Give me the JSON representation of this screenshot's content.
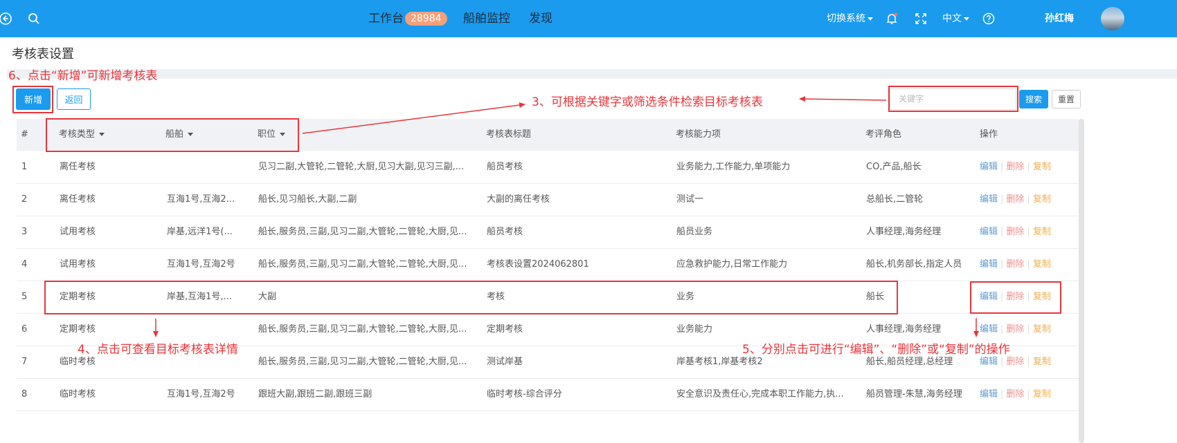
{
  "header": {
    "nav": [
      {
        "label": "工作台",
        "badge": "28984"
      },
      {
        "label": "船舶监控"
      },
      {
        "label": "发现"
      }
    ],
    "switch_system": "切换系统",
    "language": "中文",
    "user_name": "孙红梅"
  },
  "page": {
    "title": "考核表设置"
  },
  "toolbar": {
    "add_label": "新增",
    "back_label": "返回",
    "search_placeholder": "关键字",
    "search_label": "搜索",
    "reset_label": "重置"
  },
  "table": {
    "columns": [
      "#",
      "考核类型",
      "船舶",
      "职位",
      "考核表标题",
      "考核能力项",
      "考评角色",
      "操作"
    ],
    "actions": {
      "edit": "编辑",
      "delete": "删除",
      "copy": "复制"
    },
    "rows": [
      [
        "1",
        "离任考核",
        "",
        "见习二副,大管轮,二管轮,大厨,见习大副,见习三副,...",
        "船员考核",
        "业务能力,工作能力,单项能力",
        "CO,产品,船长"
      ],
      [
        "2",
        "离任考核",
        "互海1号,互海2...",
        "船长,见习船长,大副,二副",
        "大副的离任考核",
        "测试一",
        "总船长,二管轮"
      ],
      [
        "3",
        "试用考核",
        "岸基,远洋1号(...",
        "船长,服务员,三副,见习二副,大管轮,二管轮,大厨,见...",
        "船员考核",
        "船员业务",
        "人事经理,海务经理"
      ],
      [
        "4",
        "试用考核",
        "互海1号,互海2号",
        "船长,服务员,三副,见习二副,大管轮,二管轮,大厨,见...",
        "考核表设置2024062801",
        "应急救护能力,日常工作能力",
        "船长,机务部长,指定人员"
      ],
      [
        "5",
        "定期考核",
        "岸基,互海1号,...",
        "大副",
        "考核",
        "业务",
        "船长"
      ],
      [
        "6",
        "定期考核",
        "",
        "船长,服务员,三副,见习二副,大管轮,二管轮,大厨,见...",
        "定期考核",
        "业务能力",
        "人事经理,海务经理"
      ],
      [
        "7",
        "临时考核",
        "",
        "船长,服务员,三副,见习二副,大管轮,二管轮,大厨,见...",
        "测试岸基",
        "岸基考核1,岸基考核2",
        "船长,船员经理,总经理"
      ],
      [
        "8",
        "临时考核",
        "互海1号,互海2号",
        "跟班大副,跟班二副,跟班三副",
        "临时考核-综合评分",
        "安全意识及责任心,完成本职工作能力,执...",
        "船员管理-朱慧,海务经理"
      ]
    ]
  },
  "annotations": {
    "a3": "3、可根据关键字或筛选条件检索目标考核表",
    "a4": "4、点击可查看目标考核表详情",
    "a5": "5、分别点击可进行“编辑”、“删除”或“复制”的操作",
    "a6": "6、点击“新增”可新增考核表"
  },
  "colors": {
    "header_bg": "#1a9bee",
    "annotation_red": "#e8353a",
    "badge_bg": "#f5a07a"
  }
}
